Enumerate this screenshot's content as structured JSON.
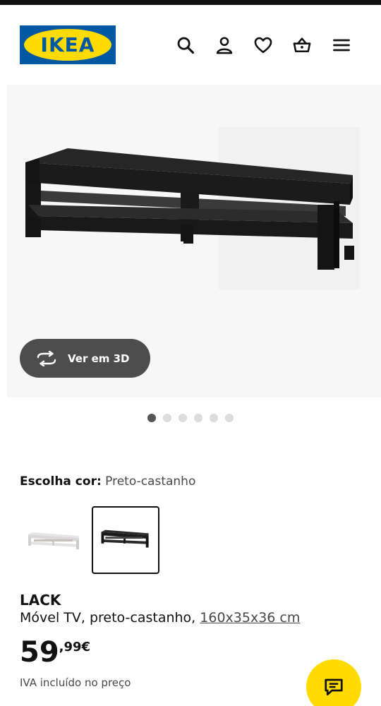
{
  "header": {
    "logo_text": "IKEA",
    "icons": [
      "search-icon",
      "account-icon",
      "heart-icon",
      "basket-icon",
      "menu-icon"
    ]
  },
  "gallery": {
    "view_3d_label": "Ver em 3D",
    "image_count": 6,
    "active_index": 0
  },
  "color_choice": {
    "label": "Escolha cor:",
    "value": "Preto-castanho",
    "options": [
      "branco",
      "preto-castanho"
    ],
    "selected": "preto-castanho"
  },
  "product": {
    "name": "LACK",
    "description": "Móvel TV, preto-castanho,",
    "dimensions": "160x35x36 cm",
    "price_integer": "59",
    "price_decimal": ",99€",
    "vat_note": "IVA incluído no preço"
  },
  "colors": {
    "brand_blue": "#0058a3",
    "brand_yellow": "#ffdb00",
    "product_dark": "#1c1c1c"
  }
}
